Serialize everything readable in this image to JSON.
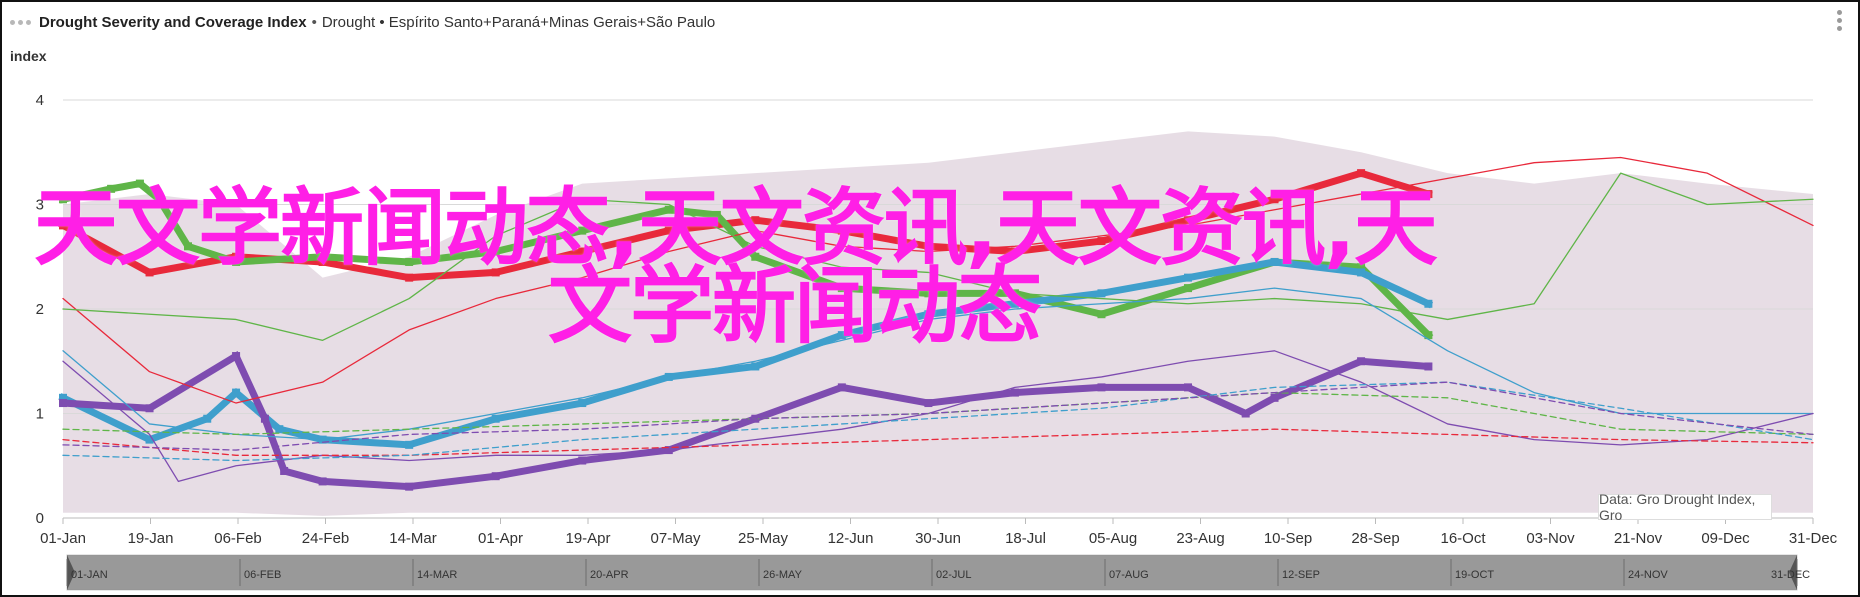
{
  "header": {
    "title": "Drought Severity and Coverage Index",
    "separator": "•",
    "subtitle": "Drought • Espírito Santo+Paraná+Minas Gerais+São Paulo",
    "y_unit": "index"
  },
  "credit": "Data: Gro Drought Index, Gro",
  "overlay": {
    "line1": "天文学新闻动态,天文资讯,天文资讯,天",
    "line2": "文学新闻动态"
  },
  "navigator": {
    "labels": [
      "01-JAN",
      "06-FEB",
      "14-MAR",
      "20-APR",
      "26-MAY",
      "02-JUL",
      "07-AUG",
      "12-SEP",
      "19-OCT",
      "24-NOV",
      "31-DEC"
    ]
  },
  "chart_data": {
    "type": "line",
    "title": "Drought Severity and Coverage Index",
    "ylabel": "index",
    "ylim": [
      0,
      4
    ],
    "yticks": [
      "0",
      "1",
      "2",
      "3",
      "4"
    ],
    "xticks": [
      "01-Jan",
      "19-Jan",
      "06-Feb",
      "24-Feb",
      "14-Mar",
      "01-Apr",
      "19-Apr",
      "07-May",
      "25-May",
      "12-Jun",
      "30-Jun",
      "18-Jul",
      "05-Aug",
      "23-Aug",
      "10-Sep",
      "28-Sep",
      "16-Oct",
      "03-Nov",
      "21-Nov",
      "09-Dec",
      "31-Dec"
    ],
    "x_range_days": [
      0,
      364
    ],
    "grid": true,
    "colors": {
      "red": "#e8293b",
      "green": "#5fb548",
      "blue": "#3f9fcc",
      "purple": "#7e4cb0",
      "band": "#c9b4c6"
    },
    "band": {
      "x": [
        0,
        18,
        36,
        54,
        72,
        90,
        108,
        126,
        144,
        162,
        180,
        198,
        216,
        234,
        252,
        270,
        288,
        306,
        324,
        342,
        364
      ],
      "low": [
        0.05,
        0.05,
        0.05,
        0.02,
        0.05,
        0.05,
        0.05,
        0.05,
        0.05,
        0.05,
        0.05,
        0.05,
        0.05,
        0.05,
        0.05,
        0.05,
        0.05,
        0.05,
        0.05,
        0.05,
        0.05
      ],
      "high": [
        3.0,
        3.1,
        3.0,
        2.3,
        2.5,
        2.9,
        3.2,
        3.25,
        3.3,
        3.35,
        3.4,
        3.5,
        3.6,
        3.7,
        3.65,
        3.5,
        3.3,
        3.2,
        3.3,
        3.2,
        3.1
      ]
    },
    "series": [
      {
        "color": "red",
        "style": "bold",
        "x": [
          0,
          18,
          36,
          54,
          72,
          90,
          108,
          126,
          144,
          162,
          180,
          198,
          216,
          234,
          252,
          270,
          284
        ],
        "y": [
          2.8,
          2.35,
          2.5,
          2.45,
          2.3,
          2.35,
          2.55,
          2.75,
          2.85,
          2.75,
          2.6,
          2.55,
          2.65,
          2.85,
          3.05,
          3.3,
          3.1
        ]
      },
      {
        "color": "green",
        "style": "bold",
        "x": [
          0,
          10,
          16,
          20,
          26,
          36,
          54,
          72,
          90,
          108,
          126,
          136,
          144,
          162,
          180,
          198,
          216,
          234,
          252,
          270,
          284
        ],
        "y": [
          3.05,
          3.15,
          3.2,
          3.05,
          2.6,
          2.45,
          2.5,
          2.45,
          2.55,
          2.75,
          2.95,
          2.9,
          2.5,
          2.2,
          2.15,
          2.15,
          1.95,
          2.2,
          2.45,
          2.4,
          1.75
        ]
      },
      {
        "color": "blue",
        "style": "bold",
        "x": [
          0,
          18,
          30,
          36,
          45,
          54,
          72,
          90,
          108,
          126,
          144,
          162,
          180,
          198,
          216,
          234,
          252,
          270,
          284
        ],
        "y": [
          1.15,
          0.75,
          0.95,
          1.2,
          0.85,
          0.75,
          0.7,
          0.95,
          1.1,
          1.35,
          1.45,
          1.75,
          1.95,
          2.05,
          2.15,
          2.3,
          2.45,
          2.35,
          2.05
        ]
      },
      {
        "color": "purple",
        "style": "bold",
        "x": [
          0,
          18,
          36,
          42,
          46,
          54,
          72,
          90,
          108,
          126,
          144,
          162,
          180,
          198,
          216,
          234,
          246,
          252,
          270,
          284
        ],
        "y": [
          1.1,
          1.05,
          1.55,
          0.95,
          0.45,
          0.35,
          0.3,
          0.4,
          0.55,
          0.65,
          0.95,
          1.25,
          1.1,
          1.2,
          1.25,
          1.25,
          1.0,
          1.15,
          1.5,
          1.45
        ]
      },
      {
        "color": "red",
        "style": "thin",
        "x": [
          0,
          18,
          36,
          54,
          72,
          90,
          108,
          126,
          144,
          162,
          180,
          198,
          216,
          234,
          252,
          270,
          288,
          306,
          324,
          342,
          364
        ],
        "y": [
          2.1,
          1.4,
          1.1,
          1.3,
          1.8,
          2.1,
          2.3,
          2.55,
          2.75,
          2.6,
          2.55,
          2.6,
          2.7,
          2.8,
          2.95,
          3.1,
          3.25,
          3.4,
          3.45,
          3.3,
          2.8
        ]
      },
      {
        "color": "green",
        "style": "thin",
        "x": [
          0,
          36,
          54,
          72,
          90,
          108,
          126,
          144,
          162,
          180,
          198,
          216,
          234,
          252,
          270,
          288,
          306,
          324,
          342,
          364
        ],
        "y": [
          2.0,
          1.9,
          1.7,
          2.1,
          2.7,
          3.05,
          3.0,
          2.6,
          2.4,
          2.35,
          2.15,
          2.1,
          2.05,
          2.1,
          2.05,
          1.9,
          2.05,
          3.3,
          3.0,
          3.05
        ]
      },
      {
        "color": "blue",
        "style": "thin",
        "x": [
          0,
          18,
          36,
          54,
          72,
          90,
          108,
          126,
          144,
          162,
          180,
          198,
          216,
          234,
          252,
          270,
          288,
          306,
          324,
          342,
          364
        ],
        "y": [
          1.6,
          0.9,
          0.8,
          0.75,
          0.85,
          1.0,
          1.15,
          1.35,
          1.5,
          1.7,
          1.9,
          2.0,
          2.05,
          2.1,
          2.2,
          2.1,
          1.6,
          1.2,
          1.0,
          1.0,
          1.0
        ]
      },
      {
        "color": "purple",
        "style": "thin",
        "x": [
          0,
          18,
          24,
          36,
          54,
          72,
          90,
          108,
          126,
          144,
          162,
          180,
          198,
          216,
          234,
          252,
          270,
          288,
          306,
          324,
          342,
          364
        ],
        "y": [
          1.5,
          0.8,
          0.35,
          0.5,
          0.6,
          0.55,
          0.6,
          0.6,
          0.65,
          0.75,
          0.85,
          1.0,
          1.25,
          1.35,
          1.5,
          1.6,
          1.3,
          0.9,
          0.75,
          0.7,
          0.75,
          1.0
        ]
      },
      {
        "color": "red",
        "style": "dashed",
        "x": [
          0,
          36,
          72,
          108,
          144,
          180,
          216,
          252,
          288,
          324,
          364
        ],
        "y": [
          0.75,
          0.6,
          0.6,
          0.65,
          0.7,
          0.75,
          0.8,
          0.85,
          0.8,
          0.75,
          0.72
        ]
      },
      {
        "color": "green",
        "style": "dashed",
        "x": [
          0,
          36,
          72,
          108,
          144,
          180,
          216,
          252,
          288,
          324,
          364
        ],
        "y": [
          0.85,
          0.8,
          0.85,
          0.9,
          0.95,
          1.0,
          1.1,
          1.2,
          1.15,
          0.85,
          0.8
        ]
      },
      {
        "color": "blue",
        "style": "dashed",
        "x": [
          0,
          36,
          72,
          108,
          144,
          180,
          216,
          252,
          288,
          324,
          364
        ],
        "y": [
          0.6,
          0.55,
          0.6,
          0.75,
          0.85,
          0.95,
          1.05,
          1.25,
          1.3,
          1.05,
          0.75
        ]
      },
      {
        "color": "purple",
        "style": "dashed",
        "x": [
          0,
          36,
          72,
          108,
          144,
          180,
          216,
          252,
          288,
          324,
          364
        ],
        "y": [
          0.7,
          0.65,
          0.8,
          0.85,
          0.95,
          1.0,
          1.1,
          1.2,
          1.3,
          1.0,
          0.8
        ]
      }
    ]
  }
}
